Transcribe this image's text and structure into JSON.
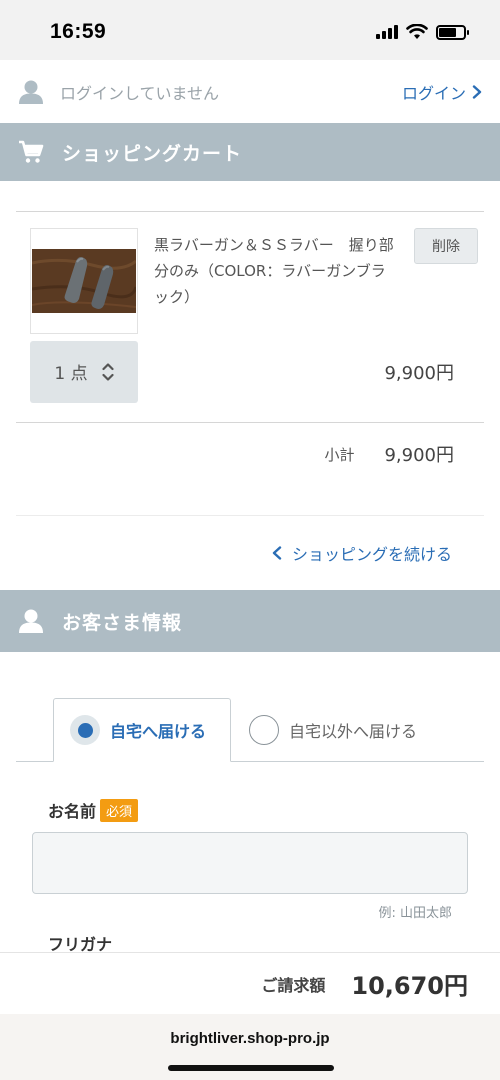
{
  "status_bar": {
    "time": "16:59"
  },
  "login_bar": {
    "status": "ログインしていません",
    "login_link": "ログイン"
  },
  "cart_section": {
    "title": "ショッピングカート"
  },
  "cart": {
    "item_name": "黒ラバーガン＆ＳＳラバー　握り部分のみ（COLOR：ラバーガンブラック）",
    "delete_label": "削除",
    "quantity": "1 点",
    "price": "9,900円",
    "subtotal_label": "小計",
    "subtotal_value": "9,900円",
    "continue_label": "ショッピングを続ける"
  },
  "customer_section": {
    "title": "お客さま情報"
  },
  "delivery_tabs": [
    {
      "label": "自宅へ届ける",
      "selected": true
    },
    {
      "label": "自宅以外へ届ける",
      "selected": false
    }
  ],
  "form": {
    "name_label": "お名前",
    "required_badge": "必須",
    "name_value": "",
    "name_example": "例: 山田太郎",
    "furigana_label": "フリガナ"
  },
  "total": {
    "label": "ご請求額",
    "value": "10,670円"
  },
  "browser": {
    "url": "brightliver.shop-pro.jp"
  },
  "colors": {
    "accent": "#2a6db5",
    "section_header": "#aebcc4",
    "required": "#f39c12"
  }
}
